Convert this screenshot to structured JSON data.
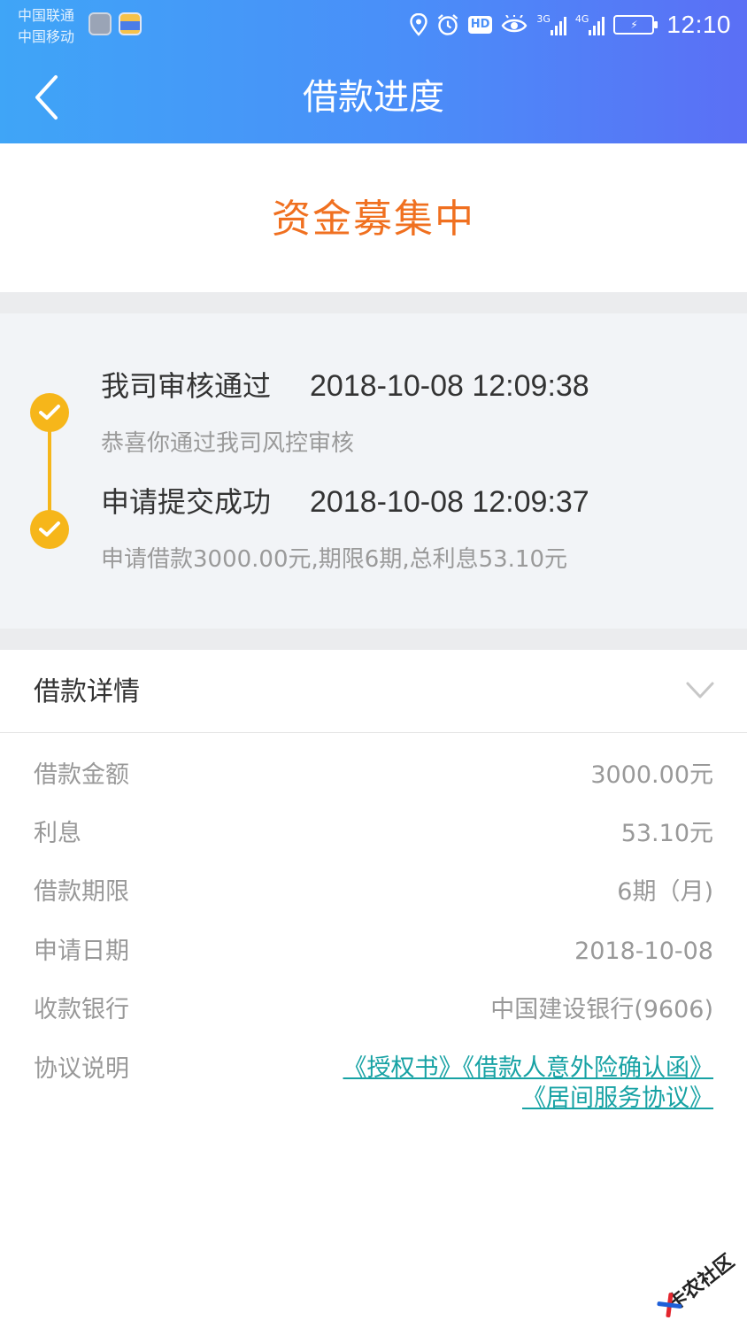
{
  "statusbar": {
    "carrier_1": "中国联通",
    "carrier_2": "中国移动",
    "hd": "HD",
    "net_1": "3G",
    "net_2": "4G",
    "time": "12:10"
  },
  "header": {
    "title": "借款进度",
    "back_icon": "chevron-left-icon"
  },
  "progress": {
    "status": "资金募集中",
    "status_color": "#f07020"
  },
  "timeline": {
    "accent": "#f6b61a",
    "items": [
      {
        "title": "我司审核通过",
        "time": "2018-10-08 12:09:38",
        "desc": "恭喜你通过我司风控审核"
      },
      {
        "title": "申请提交成功",
        "time": "2018-10-08 12:09:37",
        "desc": "申请借款3000.00元,期限6期,总利息53.10元"
      }
    ]
  },
  "details": {
    "title": "借款详情",
    "rows": [
      {
        "label": "借款金额",
        "value": "3000.00元"
      },
      {
        "label": "利息",
        "value": "53.10元"
      },
      {
        "label": "借款期限",
        "value": "6期（月)"
      },
      {
        "label": "申请日期",
        "value": "2018-10-08"
      },
      {
        "label": "收款银行",
        "value": "中国建设银行(9606)"
      }
    ],
    "agreement_label": "协议说明",
    "agreements": [
      "《授权书》",
      "《借款人意外险确认函》",
      "《居间服务协议》"
    ],
    "link_color": "#17a2a4"
  },
  "watermark": {
    "text": "卡农社区"
  }
}
